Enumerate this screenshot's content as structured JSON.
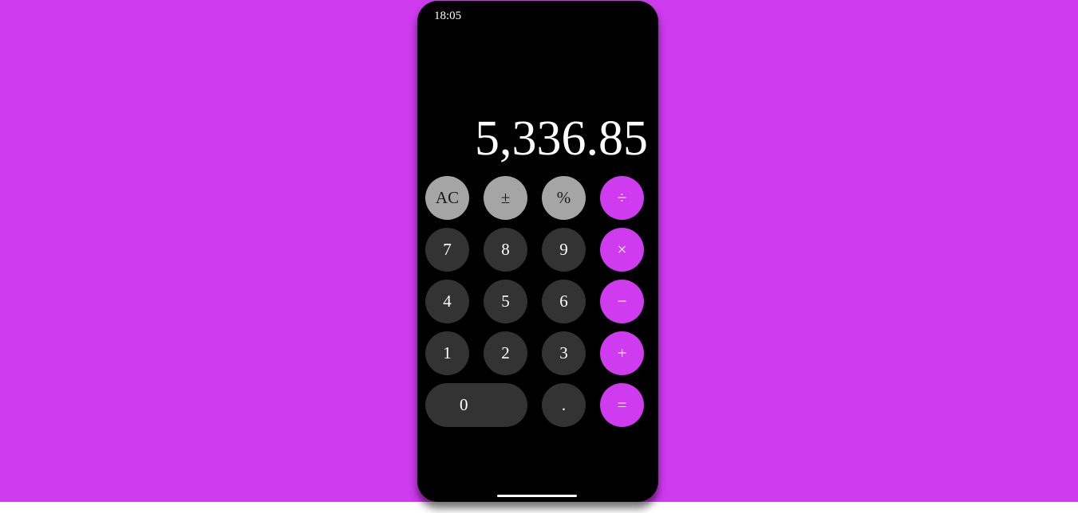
{
  "colors": {
    "background": "#cf3bef",
    "phone": "#000000",
    "function_key": "#a5a5a5",
    "number_key": "#333333",
    "operator_key": "#cf3bef",
    "text": "#ffffff"
  },
  "status_bar": {
    "time": "18:05"
  },
  "display": {
    "value": "5,336.85"
  },
  "keys": {
    "clear": "AC",
    "sign": "±",
    "percent": "%",
    "divide": "÷",
    "multiply": "×",
    "subtract": "−",
    "add": "+",
    "equals": "=",
    "seven": "7",
    "eight": "8",
    "nine": "9",
    "four": "4",
    "five": "5",
    "six": "6",
    "one": "1",
    "two": "2",
    "three": "3",
    "zero": "0",
    "decimal": "."
  }
}
